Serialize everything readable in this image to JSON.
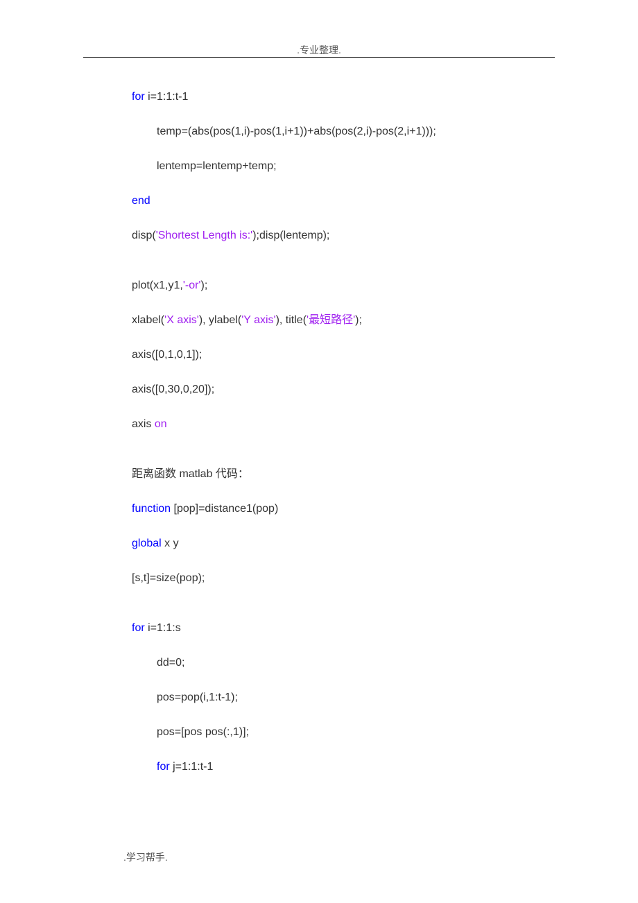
{
  "header": {
    "title": ".专业整理."
  },
  "footer": {
    "text": ".学习帮手."
  },
  "code": {
    "l1_kw": "for",
    "l1_rest": " i=1:1:t-1",
    "l2": " temp=(abs(pos(1,i)-pos(1,i+1))+abs(pos(2,i)-pos(2,i+1)));",
    "l3": " lentemp=lentemp+temp;",
    "l4": "end",
    "l5_a": "disp(",
    "l5_str": "'Shortest Length is:'",
    "l5_b": ");disp(lentemp);",
    "l6_a": "plot(x1,y1,",
    "l6_str": "'-or'",
    "l6_b": ");",
    "l7_a": "xlabel(",
    "l7_str1": "'X axis'",
    "l7_b": "), ylabel(",
    "l7_str2": "'Y axis'",
    "l7_c": "), title(",
    "l7_str3": "'最短路径'",
    "l7_d": ");",
    "l8": "axis([0,1,0,1]);",
    "l9": "axis([0,30,0,20]);",
    "l10_a": "axis ",
    "l10_str": "on",
    "l11": "距离函数 matlab 代码：",
    "l12_kw": "function",
    "l12_rest": " [pop]=distance1(pop)",
    "l13_kw": "global",
    "l13_rest": " x y",
    "l14": "[s,t]=size(pop);",
    "l15_kw": "for",
    "l15_rest": " i=1:1:s",
    "l16": "dd=0;",
    "l17": "pos=pop(i,1:t-1);",
    "l18": "pos=[pos pos(:,1)];",
    "l19_kw": "for",
    "l19_rest": " j=1:1:t-1"
  }
}
